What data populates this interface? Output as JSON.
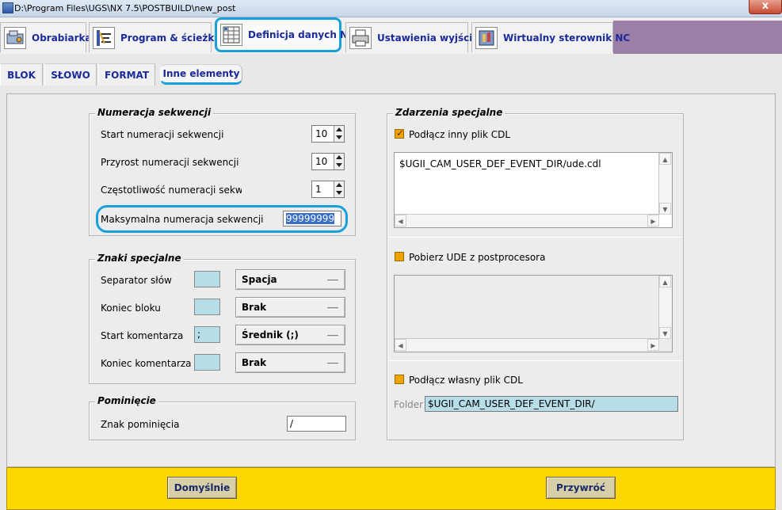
{
  "window": {
    "title": "D:\\Program Files\\UGS\\NX 7.5\\POSTBUILD\\new_post",
    "close_glyph": "x"
  },
  "main_tabs": [
    {
      "label": "Obrabiarka",
      "icon": "machine-icon"
    },
    {
      "label": "Program & ścieżka",
      "icon": "program-path-icon"
    },
    {
      "label": "Definicja danych NC",
      "icon": "nc-data-icon"
    },
    {
      "label": "Ustawienia wyjścia",
      "icon": "printer-icon"
    },
    {
      "label": "Wirtualny sterownik NC",
      "icon": "virtual-controller-icon"
    }
  ],
  "sub_tabs": [
    "BLOK",
    "SŁOWO",
    "FORMAT",
    "Inne elementy"
  ],
  "sequence": {
    "title": "Numeracja sekwencji",
    "start_label": "Start numeracji sekwencji",
    "start_value": "10",
    "increment_label": "Przyrost numeracji sekwencji",
    "increment_value": "10",
    "frequency_label": "Częstotliwość numeracji sekwer",
    "frequency_value": "1",
    "max_label": "Maksymalna numeracja sekwencji",
    "max_value": "99999999"
  },
  "special_chars": {
    "title": "Znaki specjalne",
    "word_sep_label": "Separator słów",
    "word_sep_value": "Spacja",
    "block_end_label": "Koniec bloku",
    "block_end_value": "Brak",
    "comment_start_label": "Start komentarza",
    "comment_start_char": ";",
    "comment_start_value": "Średnik (;)",
    "comment_end_label": "Koniec komentarza",
    "comment_end_value": "Brak"
  },
  "skip": {
    "title": "Pominięcie",
    "char_label": "Znak pominięcia",
    "char_value": "/"
  },
  "events": {
    "title": "Zdarzenia specjalne",
    "include_cdl_label": "Podłącz inny plik CDL",
    "include_cdl_checked": true,
    "cdl_path": "$UGII_CAM_USER_DEF_EVENT_DIR/ude.cdl",
    "get_ude_label": "Pobierz UDE z postprocesora",
    "own_cdl_label": "Podłącz własny plik CDL",
    "folder_label": "Folder",
    "folder_value": "$UGII_CAM_USER_DEF_EVENT_DIR/"
  },
  "buttons": {
    "default": "Domyślnie",
    "restore": "Przywróć"
  }
}
